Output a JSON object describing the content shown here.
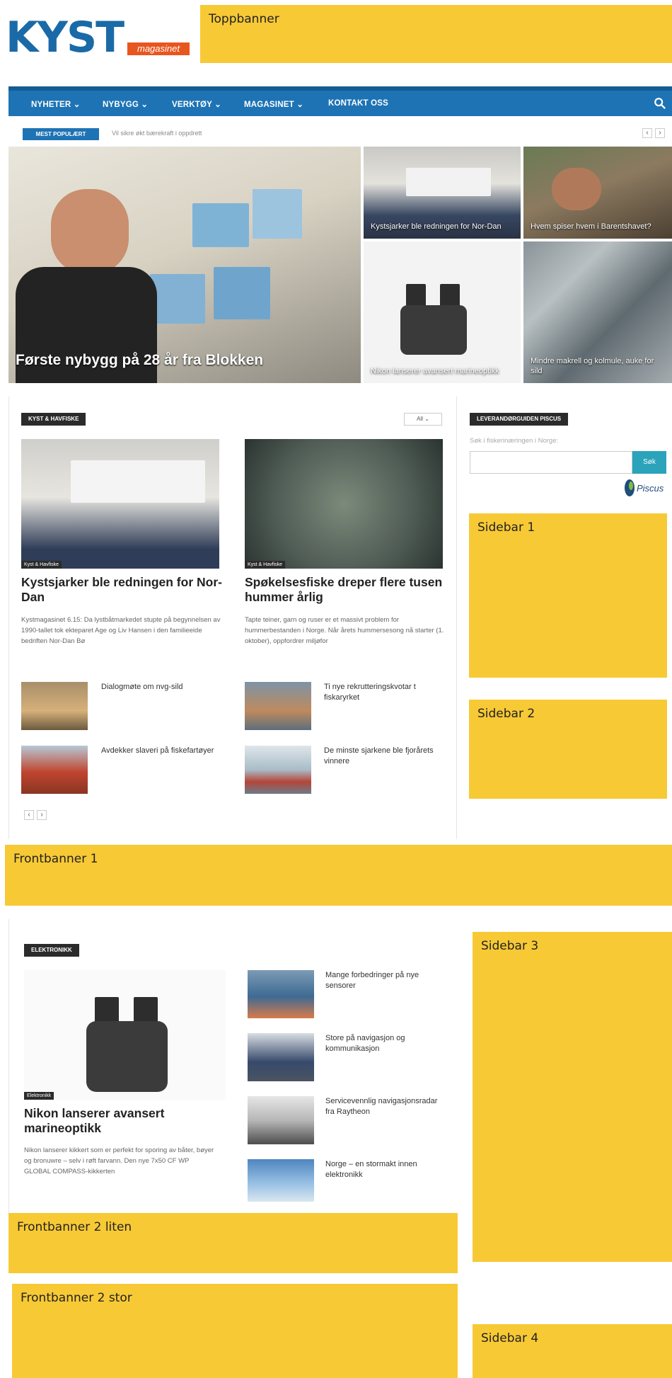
{
  "logo": {
    "brand": "KYST",
    "sub": "magasinet"
  },
  "ads": {
    "top": "Toppbanner",
    "sidebar1": "Sidebar 1",
    "sidebar2": "Sidebar 2",
    "sidebar3": "Sidebar 3",
    "sidebar4": "Sidebar 4",
    "front1": "Frontbanner 1",
    "front2_small": "Frontbanner 2 liten",
    "front2_big": "Frontbanner 2 stor"
  },
  "nav": {
    "items": [
      "NYHETER ⌄",
      "NYBYGG ⌄",
      "VERKTØY ⌄",
      "MAGASINET ⌄",
      "KONTAKT OSS"
    ],
    "search_icon": "search-icon"
  },
  "ticker": {
    "badge": "MEST POPULÆRT",
    "text": "Vil sikre økt bærekraft i oppdrett",
    "prev": "‹",
    "next": "›"
  },
  "hero": {
    "main": "Første nybygg på 28 år fra Blokken",
    "t1": "Kystsjarker ble redningen for Nor-Dan",
    "t2": "Hvem spiser hvem i Barentshavet?",
    "t3": "Nikon lanserer avansert marineoptikk",
    "t4": "Mindre makrell og kolmule, auke for sild"
  },
  "kyst": {
    "label": "KYST & HAVFISKE",
    "filter": "All ⌄",
    "a1": {
      "tag": "Kyst & Havfiske",
      "title": "Kystsjarker ble redningen for Nor-Dan",
      "excerpt": "Kystmagasinet 6.15: Da lystbåtmarkedet stupte på begynnelsen av 1990-tallet tok ekteparet Age og Liv Hansen i den familieeide bedriften Nor-Dan Bø"
    },
    "a2": {
      "tag": "Kyst & Havfiske",
      "title": "Spøkelsesfiske dreper flere tusen hummer årlig",
      "excerpt": "Tapte teiner, garn og ruser er et massivt problem for hummerbestanden i Norge. Når årets hummersesong nå starter (1. oktober), oppfordrer miljøfor"
    },
    "small": [
      "Dialogmøte om nvg-sild",
      "Ti nye rekrutteringskvotar t fiskaryrket",
      "Avdekker slaveri på fiskefartøyer",
      "De minste sjarkene ble fjorårets vinnere"
    ],
    "prev": "‹",
    "next": "›"
  },
  "piscus": {
    "label": "LEVERANDØRGUIDEN PISCUS",
    "prompt": "Søk i fiskerinæringen i Norge:",
    "button": "Søk",
    "logo": "Piscus"
  },
  "elektronikk": {
    "label": "ELEKTRONIKK",
    "tag": "Elektronikk",
    "title": "Nikon lanserer avansert marineoptikk",
    "excerpt": "Nikon lanserer kikkert som er perfekt for sporing av båter, bøyer og bronuwre – selv i røft farvann. Den nye 7x50 CF WP GLOBAL COMPASS-kikkerten",
    "small": [
      "Mange forbedringer på nye sensorer",
      "Store på navigasjon og kommunikasjon",
      "Servicevennlig navigasjonsradar fra Raytheon",
      "Norge – en stormakt innen elektronikk"
    ]
  }
}
